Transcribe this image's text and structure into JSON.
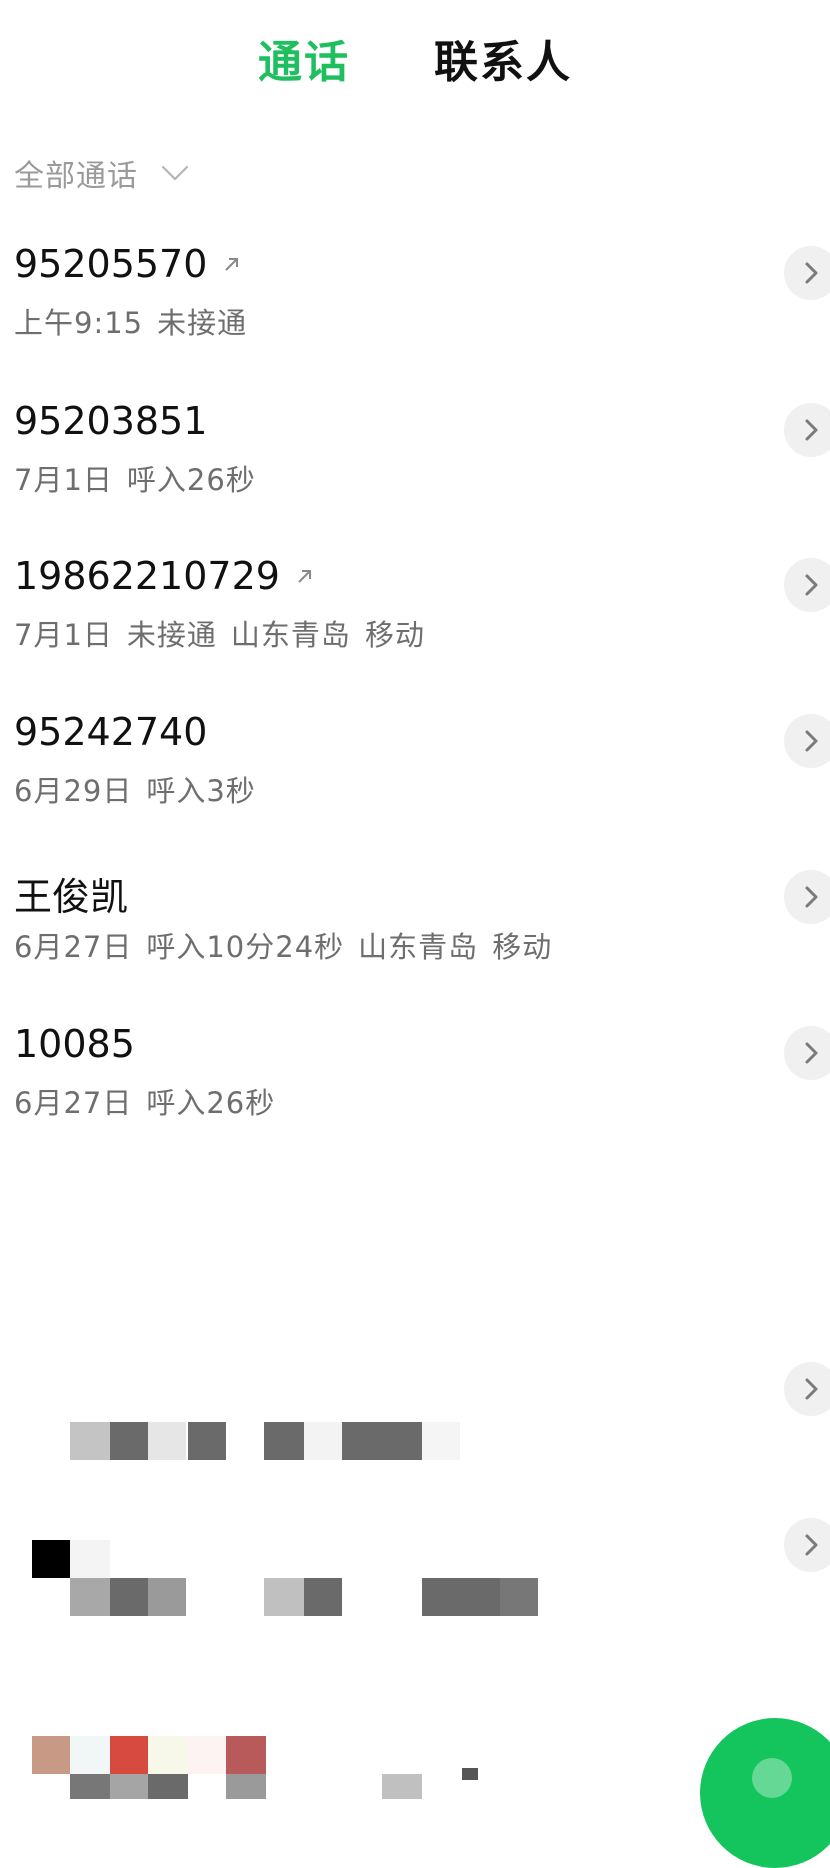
{
  "tabs": {
    "calls": "通话",
    "contacts": "联系人"
  },
  "filter": {
    "label": "全部通话"
  },
  "calls": [
    {
      "title": "95205570",
      "outgoing": true,
      "details": [
        "上午9:15",
        "未接通"
      ]
    },
    {
      "title": "95203851",
      "outgoing": false,
      "details": [
        "7月1日",
        "呼入26秒"
      ]
    },
    {
      "title": "19862210729",
      "outgoing": true,
      "details": [
        "7月1日",
        "未接通",
        "山东青岛",
        "移动"
      ]
    },
    {
      "title": "95242740",
      "outgoing": false,
      "details": [
        "6月29日",
        "呼入3秒"
      ]
    },
    {
      "title": "王俊凯",
      "outgoing": false,
      "details": [
        "6月27日",
        "呼入10分24秒",
        "山东青岛",
        "移动"
      ]
    },
    {
      "title": "10085",
      "outgoing": false,
      "details": [
        "6月27日",
        "呼入26秒"
      ]
    }
  ],
  "icons": {
    "filter": "chevron-down-icon",
    "outgoing": "outgoing-call-arrow-icon",
    "details": "chevron-right-icon",
    "fab": "dial-icon"
  },
  "colors": {
    "accent": "#1fbf60",
    "fab": "#14c45c",
    "secondary_text": "#6e6e6e"
  }
}
